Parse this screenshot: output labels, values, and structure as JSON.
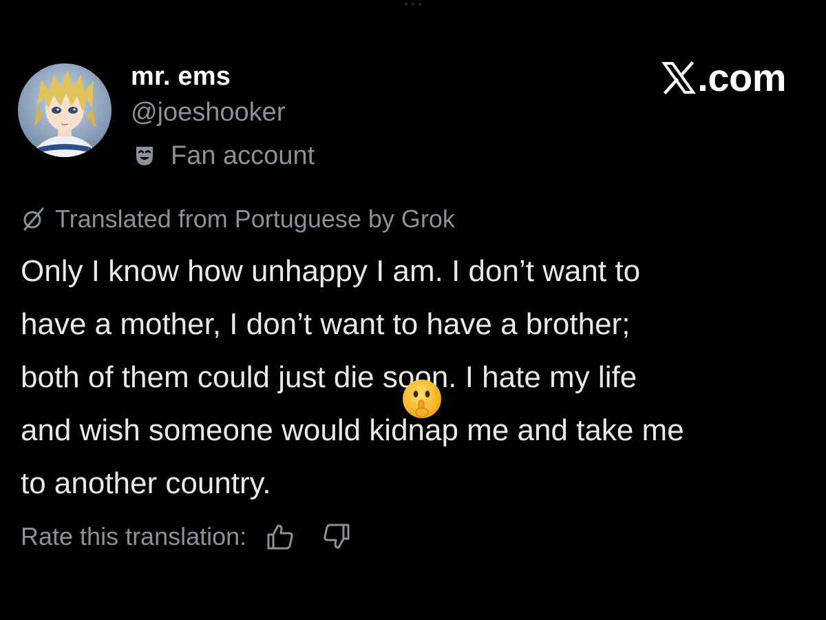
{
  "colors": {
    "background": "#000000",
    "primary_text": "#e7e9ea",
    "secondary_text": "#8b9198",
    "display_name": "#ffffff"
  },
  "author": {
    "display_name": "mr. ems",
    "handle": "@joeshooker",
    "badge_icon": "theater-mask-icon",
    "badge_label": "Fan account",
    "avatar": "anime-character-avatar"
  },
  "brand": {
    "logo_icon": "x-logo-icon",
    "suffix": ".com"
  },
  "translation": {
    "icon": "grok-icon",
    "label": "Translated from Portuguese by Grok"
  },
  "tweet": {
    "lines": [
      "Only I know how unhappy I am. I don’t want to",
      "have a mother, I don’t want to have a brother;",
      "both of them could just die soon. I hate my life",
      "and wish someone would kidnap me and take me",
      "to another country."
    ],
    "overlay_emoji": "shushing-face-emoji"
  },
  "rating": {
    "label": "Rate this translation:",
    "thumbs_up_icon": "thumbs-up-icon",
    "thumbs_down_icon": "thumbs-down-icon"
  }
}
